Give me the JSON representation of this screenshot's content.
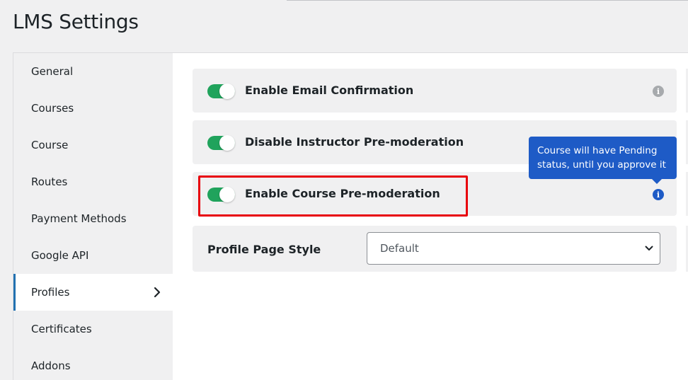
{
  "page": {
    "title": "LMS Settings"
  },
  "sidebar": {
    "items": [
      {
        "label": "General"
      },
      {
        "label": "Courses"
      },
      {
        "label": "Course"
      },
      {
        "label": "Routes"
      },
      {
        "label": "Payment Methods"
      },
      {
        "label": "Google API"
      },
      {
        "label": "Profiles",
        "active": true
      },
      {
        "label": "Certificates"
      },
      {
        "label": "Addons"
      }
    ]
  },
  "settings": {
    "email_confirmation": {
      "label": "Enable Email Confirmation",
      "enabled": true
    },
    "instructor_premoderation": {
      "label": "Disable Instructor Pre-moderation",
      "enabled": true
    },
    "course_premoderation": {
      "label": "Enable Course Pre-moderation",
      "enabled": true,
      "tooltip": "Course will have Pending status, until you approve it"
    },
    "profile_page_style": {
      "label": "Profile Page Style",
      "value": "Default"
    }
  },
  "colors": {
    "toggle_on": "#20a35c",
    "tooltip_bg": "#1e5bc6",
    "highlight": "#e8000b"
  }
}
